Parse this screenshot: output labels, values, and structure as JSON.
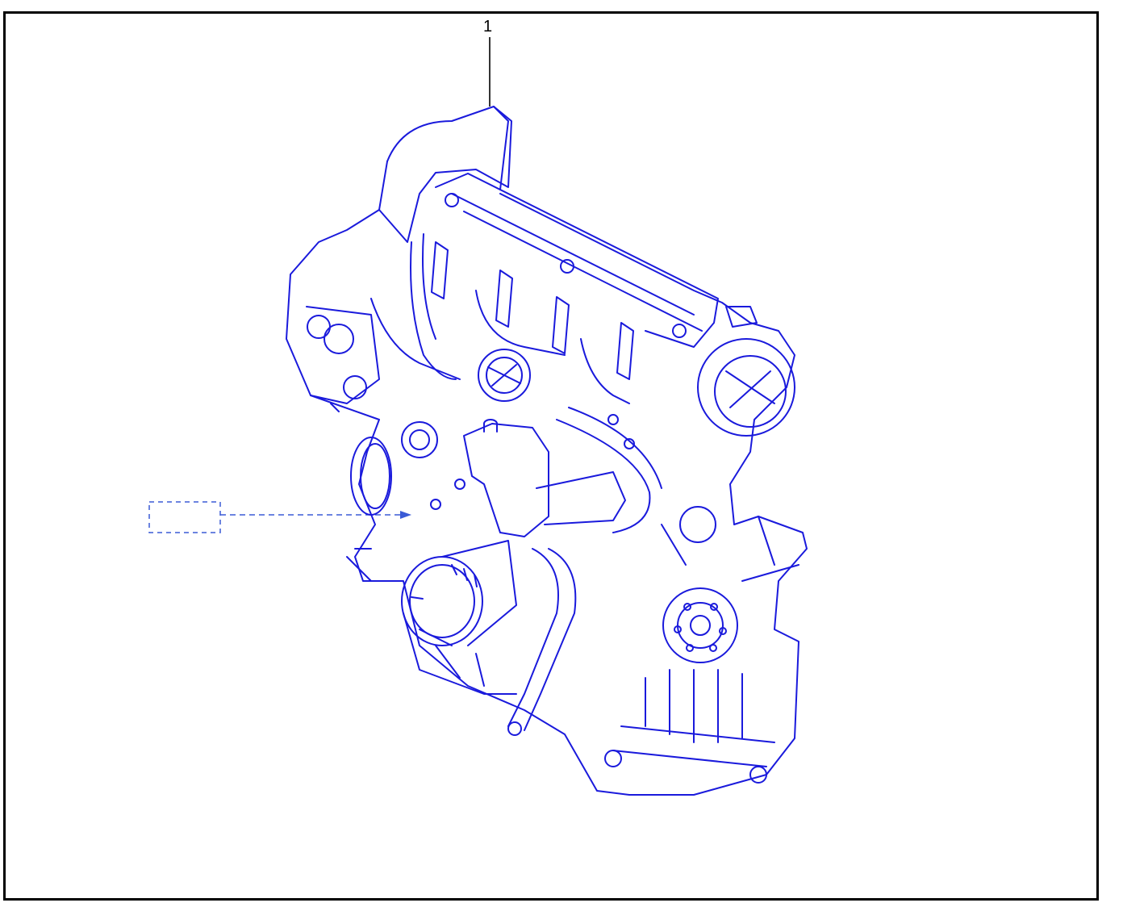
{
  "diagram": {
    "callouts": [
      {
        "label": "1",
        "target": "engine-assembly"
      }
    ],
    "reference_box": {
      "label": ""
    },
    "colors": {
      "frame": "#000000",
      "leader": "#000000",
      "line_art": "#1a1adc",
      "dashed_reference": "#3b5bd6"
    },
    "icons": [
      "engine-assembly-line-art"
    ]
  }
}
